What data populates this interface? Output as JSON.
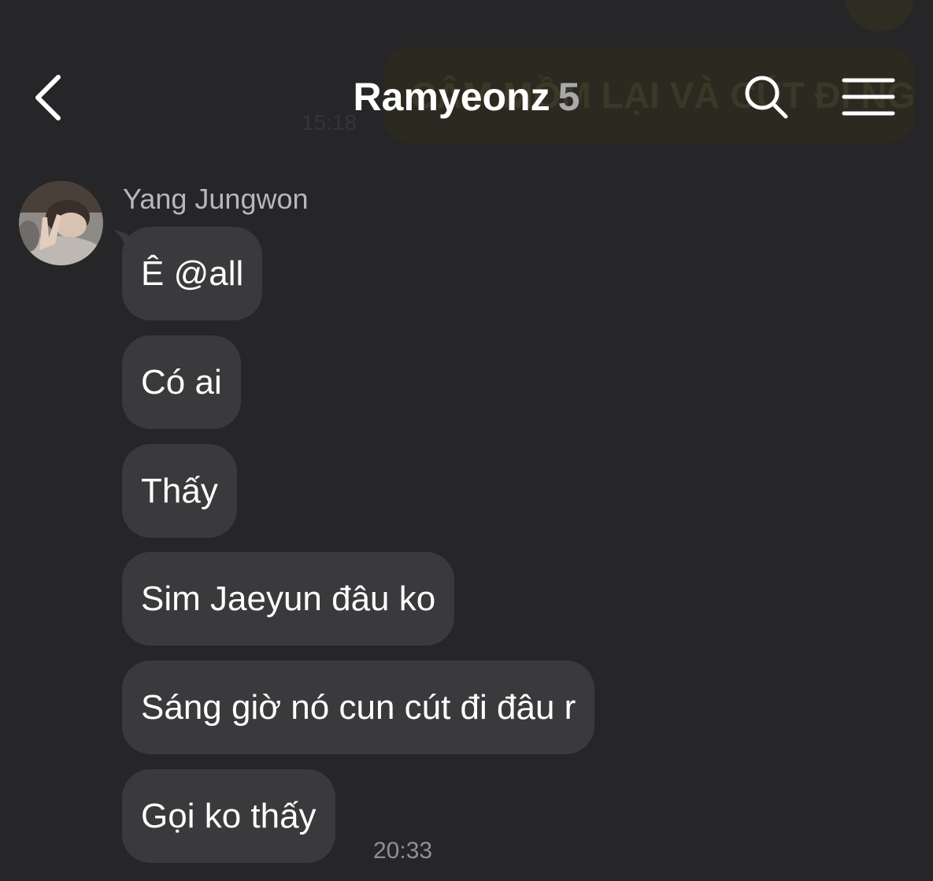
{
  "background_overlap": {
    "message_text": "CÂM MỒM LẠI VÀ CÚT ĐI NGỦ",
    "time": "15:18"
  },
  "header": {
    "title": "Ramyeonz",
    "member_count": "5",
    "back_icon": "chevron-left-icon",
    "search_icon": "search-icon",
    "menu_icon": "hamburger-menu-icon"
  },
  "conversation": {
    "sender": {
      "name": "Yang Jungwon",
      "avatar_icon": "avatar-photo"
    },
    "messages": [
      {
        "text": "Ê @all"
      },
      {
        "text": "Có ai"
      },
      {
        "text": "Thấy"
      },
      {
        "text": "Sim Jaeyun đâu ko"
      },
      {
        "text": "Sáng giờ nó cun cút đi đâu r"
      },
      {
        "text": "Gọi ko thấy"
      }
    ],
    "last_time": "20:33"
  },
  "colors": {
    "background": "#262628",
    "bubble": "#3a3a3d",
    "text": "#ffffff",
    "muted_text": "#b7b7bb",
    "member_count": "#a9a9ad"
  }
}
